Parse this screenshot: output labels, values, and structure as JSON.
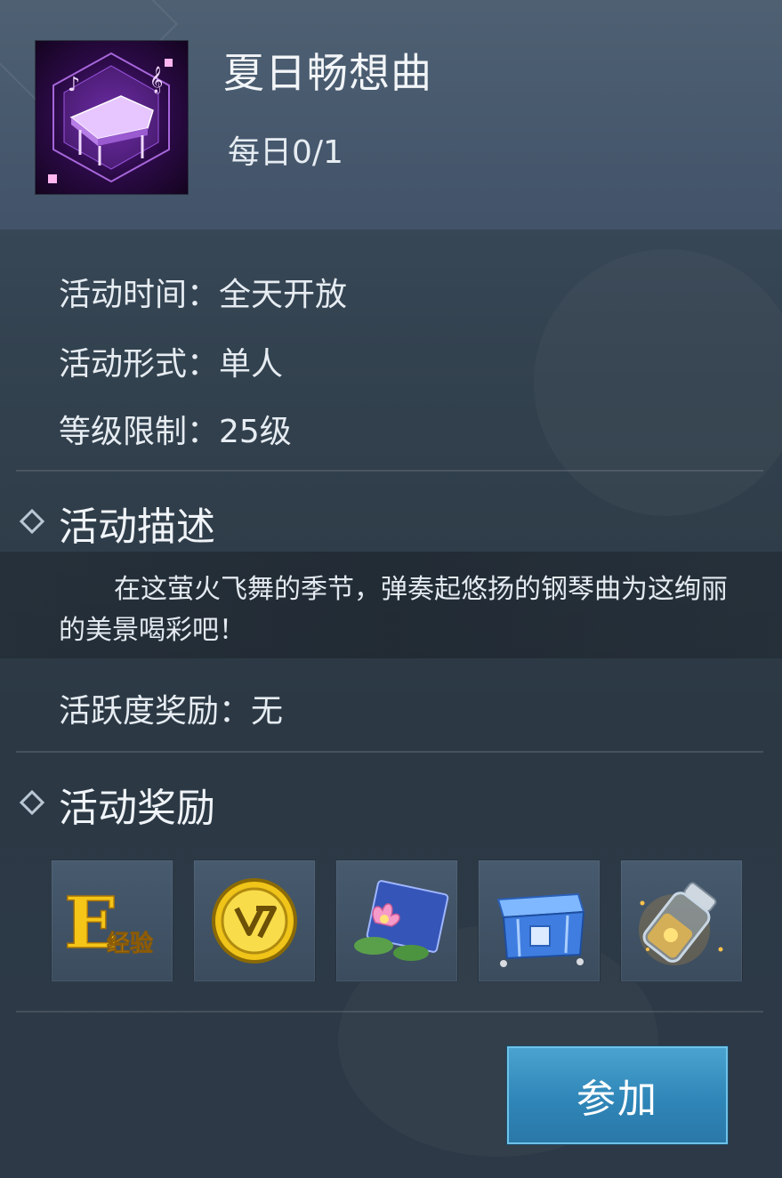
{
  "activity": {
    "title": "夏日畅想曲",
    "daily": "每日0/1",
    "icon": "piano-icon"
  },
  "info": {
    "time": "活动时间：全天开放",
    "mode": "活动形式：单人",
    "level": "等级限制：25级"
  },
  "description": {
    "section_title": "活动描述",
    "text": "在这萤火飞舞的季节，弹奏起悠扬的钢琴曲为这绚丽的美景喝彩吧！"
  },
  "activeness": "活跃度奖励：无",
  "rewards": {
    "section_title": "活动奖励",
    "items": [
      {
        "icon": "experience-icon",
        "label": "经验"
      },
      {
        "icon": "gold-coin-icon"
      },
      {
        "icon": "lotus-scroll-icon"
      },
      {
        "icon": "treasure-chest-icon"
      },
      {
        "icon": "firefly-bottle-icon"
      }
    ]
  },
  "join_button": "参加",
  "colors": {
    "button": "#2f86b8",
    "panel": "#33424f",
    "icon_bg": "#2a0a45"
  }
}
